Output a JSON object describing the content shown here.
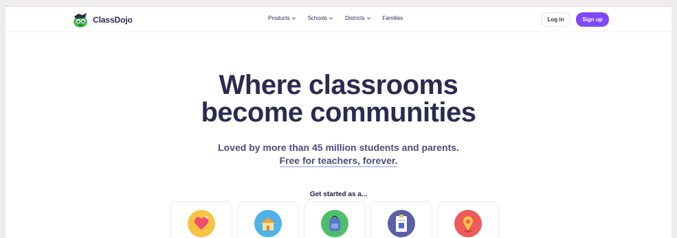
{
  "header": {
    "brand": "ClassDojo",
    "nav": [
      {
        "label": "Products",
        "dropdown": true
      },
      {
        "label": "Schools",
        "dropdown": true
      },
      {
        "label": "Districts",
        "dropdown": true
      },
      {
        "label": "Families",
        "dropdown": false
      }
    ],
    "login_label": "Log in",
    "signup_label": "Sign up"
  },
  "hero": {
    "title_line1": "Where classrooms",
    "title_line2": "become communities",
    "subtitle_line1": "Loved by more than 45 million students and parents.",
    "subtitle_line2": "Free for teachers, forever."
  },
  "get_started": {
    "label": "Get started as a...",
    "cards": [
      {
        "icon": "heart-icon",
        "color": "#f9c443"
      },
      {
        "icon": "school-house-icon",
        "color": "#4fb3e8"
      },
      {
        "icon": "backpack-icon",
        "color": "#4dbf6a"
      },
      {
        "icon": "id-badge-icon",
        "color": "#5b5fa8"
      },
      {
        "icon": "map-pin-icon",
        "color": "#ef5a5a"
      }
    ]
  },
  "colors": {
    "brand_purple": "#8047f8",
    "text_navy": "#2c2a50"
  }
}
